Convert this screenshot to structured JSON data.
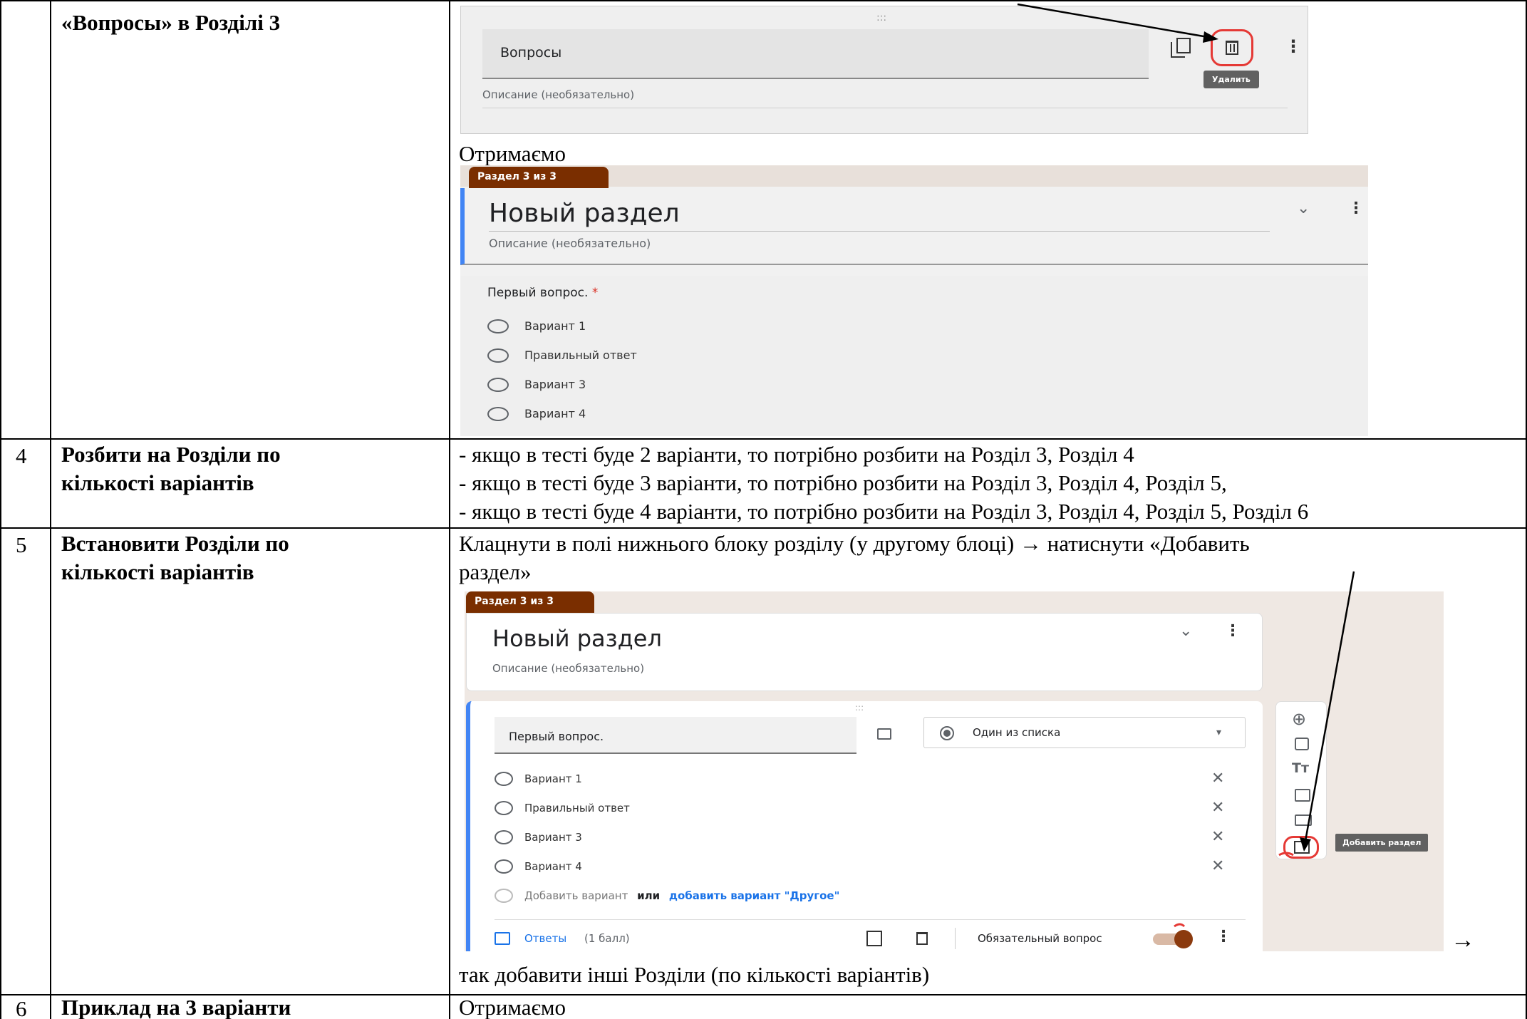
{
  "rows": [
    {
      "num": "",
      "title": "«Вопросы» в Розділі 3"
    },
    {
      "num": "4",
      "title_lines": [
        "Розбити на Розділи по",
        "кількості варіантів"
      ]
    },
    {
      "num": "5",
      "title_lines": [
        "Встановити Розділи по",
        "кількості варіантів"
      ]
    },
    {
      "num": "6",
      "title": "Приклад на 3 варіанти"
    }
  ],
  "row4_lines": [
    "- якщо в тесті буде 2 варіанти, то потрібно розбити на Розділ 3, Розділ 4",
    "- якщо в тесті буде 3 варіанти, то потрібно розбити на Розділ 3, Розділ 4, Розділ 5,",
    "- якщо в тесті буде 4 варіанти, то потрібно розбити на Розділ 3, Розділ 4, Розділ 5, Розділ 6"
  ],
  "row5_lines": [
    "Клацнути  в полі нижнього блоку розділу (у другому блоці) → натиснути «Добавить",
    "раздел»"
  ],
  "row5_after": "так добавити інші Розділи (по кількості варіантів)",
  "row5_arrow": "→",
  "row6_text": "Отримаємо",
  "row3_between": "Отримаємо",
  "shot1": {
    "title_value": "Вопросы",
    "description": "Описание (необязательно)",
    "tooltip": "Удалить",
    "drag": ":::"
  },
  "shot2": {
    "tab": "Раздел 3 из 3",
    "section_title": "Новый раздел",
    "description": "Описание (необязательно)",
    "question": "Первый вопрос.",
    "required_mark": "*",
    "options": [
      "Вариант 1",
      "Правильный ответ",
      "Вариант 3",
      "Вариант 4"
    ]
  },
  "shot3": {
    "tab": "Раздел 3 из 3",
    "section_title": "Новый раздел",
    "description": "Описание (необязательно)",
    "drag": ":::",
    "question_value": "Первый вопрос.",
    "type_label": "Один из списка",
    "options": [
      "Вариант 1",
      "Правильный ответ",
      "Вариант 3",
      "Вариант 4"
    ],
    "add_option": "Добавить вариант",
    "or": "или",
    "add_other": "добавить вариант \"Другое\"",
    "answers": "Ответы",
    "points": "(1 балл)",
    "required": "Обязательный вопрос",
    "tooltip": "Добавить раздел",
    "text_icon": "Tт"
  },
  "colors": {
    "accent_blue": "#4285f4",
    "tab_brown": "#7a2e00",
    "toggle_brown": "#8b3a0e",
    "highlight_red": "#e53935",
    "tooltip_gray": "#616161"
  }
}
